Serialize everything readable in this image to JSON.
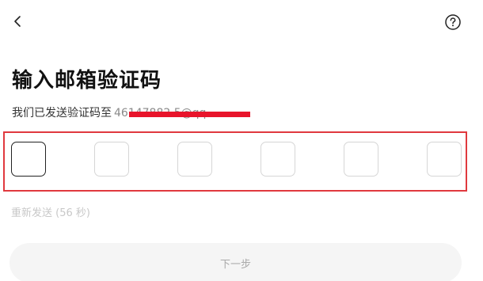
{
  "header": {
    "back_icon": "chevron-left-icon",
    "help_icon": "question-circle-icon"
  },
  "title": "输入邮箱验证码",
  "subtitle": {
    "prefix": "我们已发送验证码至",
    "masked_email": "46147882 5@qq"
  },
  "code_inputs": [
    {
      "value": "",
      "active": true
    },
    {
      "value": "",
      "active": false
    },
    {
      "value": "",
      "active": false
    },
    {
      "value": "",
      "active": false
    },
    {
      "value": "",
      "active": false
    },
    {
      "value": "",
      "active": false
    }
  ],
  "resend_label": "重新发送 (56 秒)",
  "next_button_label": "下一步",
  "colors": {
    "annotation_red": "#e0393e",
    "redaction_red": "#e8142b",
    "disabled_text": "#c8c8c8",
    "button_bg": "#f5f5f5"
  }
}
